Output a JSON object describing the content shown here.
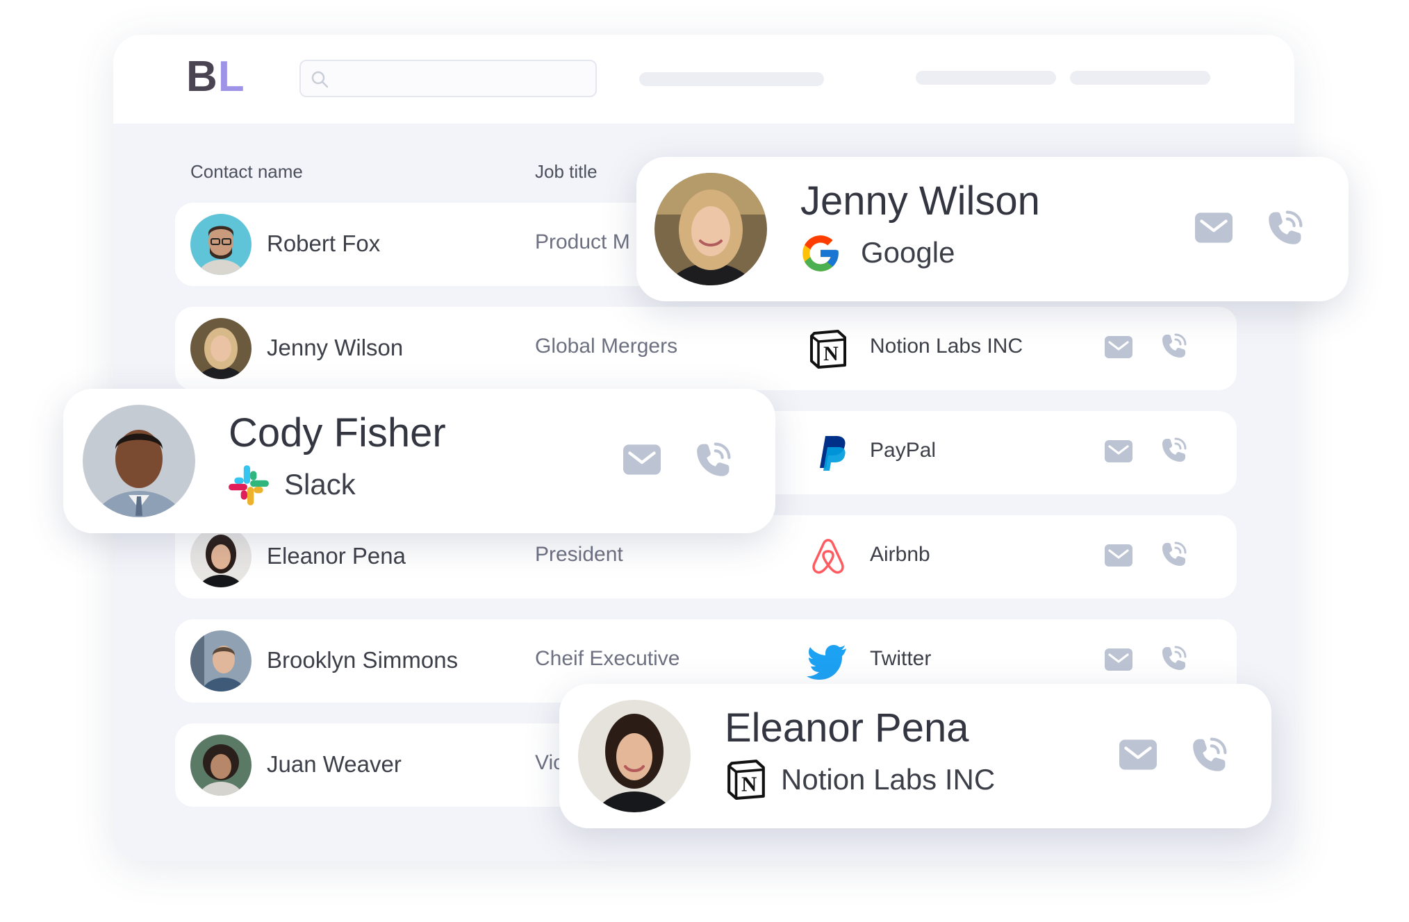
{
  "app": {
    "logo_b": "B",
    "logo_l": "L",
    "search": {
      "placeholder": ""
    }
  },
  "table": {
    "headers": {
      "contact_name": "Contact name",
      "job_title": "Job title"
    },
    "rows": [
      {
        "name": "Robert Fox",
        "job": "Product M",
        "company": "",
        "company_icon": ""
      },
      {
        "name": "Jenny Wilson",
        "job": "Global Mergers",
        "company": "Notion Labs INC",
        "company_icon": "notion-icon"
      },
      {
        "name": "",
        "job": "",
        "company": "PayPal",
        "company_icon": "paypal-icon"
      },
      {
        "name": "Eleanor Pena",
        "job": "President",
        "company": "Airbnb",
        "company_icon": "airbnb-icon"
      },
      {
        "name": "Brooklyn Simmons",
        "job": "Cheif Executive",
        "company": "Twitter",
        "company_icon": "twitter-icon"
      },
      {
        "name": "Juan Weaver",
        "job": "Vic",
        "company": "",
        "company_icon": ""
      }
    ]
  },
  "cards": {
    "jenny": {
      "name": "Jenny Wilson",
      "company": "Google",
      "company_icon": "google-icon"
    },
    "cody": {
      "name": "Cody Fisher",
      "company": "Slack",
      "company_icon": "slack-icon"
    },
    "eleanor": {
      "name": "Eleanor Pena",
      "company": "Notion Labs INC",
      "company_icon": "notion-icon"
    }
  },
  "colors": {
    "logo_b": "#4a4352",
    "logo_l": "#9f93e8",
    "action_icon": "#bcc3d3",
    "background": "#f3f4f9"
  }
}
